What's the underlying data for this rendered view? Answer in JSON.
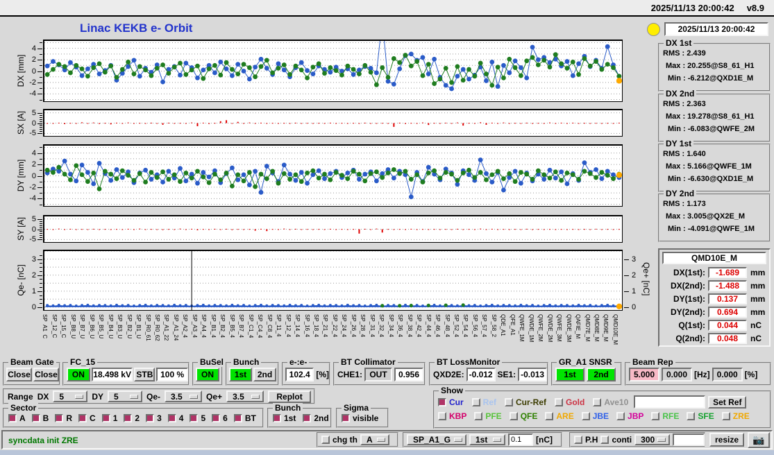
{
  "top_bar": {
    "datetime": "2025/11/13 20:00:42",
    "version": "v8.9"
  },
  "header": {
    "chart_title": "Linac KEKB e- Orbit",
    "timestamp": "2025/11/13 20:00:42",
    "indicator": "yellow-status-lamp"
  },
  "stats": {
    "dx1": {
      "title": "DX 1st",
      "rms": "RMS :  2.439",
      "max": "Max :  20.255@S8_61_H1",
      "min": "Min :  -6.212@QXD1E_M"
    },
    "dx2": {
      "title": "DX 2nd",
      "rms": "RMS :  2.363",
      "max": "Max :  19.278@S8_61_H1",
      "min": "Min :  -6.083@QWFE_2M"
    },
    "dy1": {
      "title": "DY 1st",
      "rms": "RMS :  1.640",
      "max": "Max :  5.166@QWFE_1M",
      "min": "Min :  -6.630@QXD1E_M"
    },
    "dy2": {
      "title": "DY 2nd",
      "rms": "RMS :  1.173",
      "max": "Max :  3.005@QX2E_M",
      "min": "Min :  -4.091@QWFE_1M"
    }
  },
  "selected_monitor": {
    "name": "QMD10E_M",
    "rows": [
      {
        "label": "DX(1st):",
        "value": "-1.689",
        "unit": "mm"
      },
      {
        "label": "DX(2nd):",
        "value": "-1.488",
        "unit": "mm"
      },
      {
        "label": "DY(1st):",
        "value": "0.137",
        "unit": "mm"
      },
      {
        "label": "DY(2nd):",
        "value": "0.694",
        "unit": "mm"
      },
      {
        "label": "Q(1st):",
        "value": "0.044",
        "unit": "nC"
      },
      {
        "label": "Q(2nd):",
        "value": "0.048",
        "unit": "nC"
      }
    ],
    "value_color": "#dd0000"
  },
  "controls_row1": {
    "beam_gate": {
      "title": "Beam Gate",
      "btn1": "Close",
      "btn2": "Close"
    },
    "fc_15": {
      "title": "FC_15",
      "on": "ON",
      "kv": "18.498 kV",
      "stb": "STB",
      "percent": "100 %"
    },
    "busel": {
      "title": "BuSel",
      "on": "ON"
    },
    "bunch": {
      "title": "Bunch",
      "first": "1st",
      "second": "2nd"
    },
    "ee": {
      "title": "e-:e-",
      "value": "102.4",
      "unit": "[%]"
    },
    "bt_collimator": {
      "title": "BT Collimator",
      "che1_label": "CHE1:",
      "che1_state": "OUT",
      "value": "0.956"
    },
    "bt_lossmonitor": {
      "title": "BT LossMonitor",
      "qxd2e_label": "QXD2E:",
      "qxd2e": "-0.012",
      "se1_label": "SE1:",
      "se1": "-0.013"
    },
    "gr_a1": {
      "title": "GR_A1 SNSR",
      "first": "1st",
      "second": "2nd"
    },
    "beam_rep": {
      "title": "Beam Rep",
      "v1": "5.000",
      "v2": "0.000",
      "hz": "[Hz]",
      "v3": "0.000",
      "pct": "[%]"
    }
  },
  "range_bar": {
    "label": "Range",
    "dx_label": "DX",
    "dx": "5",
    "dy_label": "DY",
    "dy": "5",
    "qem_label": "Qe-",
    "qem": "3.5",
    "qep_label": "Qe+",
    "qep": "3.5",
    "replot": "Replot"
  },
  "sector": {
    "title": "Sector",
    "items": [
      "A",
      "B",
      "R",
      "C",
      "1",
      "2",
      "3",
      "4",
      "5",
      "6",
      "BT"
    ],
    "checked": [
      true,
      true,
      true,
      true,
      true,
      true,
      true,
      true,
      true,
      true,
      true
    ]
  },
  "bunch2": {
    "title": "Bunch",
    "items": [
      "1st",
      "2nd"
    ],
    "checked": [
      true,
      true
    ]
  },
  "sigma": {
    "title": "Sigma",
    "item": "visible",
    "checked": true
  },
  "show": {
    "title": "Show",
    "row1": [
      {
        "label": "Cur",
        "color": "#2222cc",
        "checked": true
      },
      {
        "label": "Ref",
        "color": "#a9c4ef",
        "checked": false
      },
      {
        "label": "Cur-Ref",
        "color": "#3c3c00",
        "checked": false
      },
      {
        "label": "Gold",
        "color": "#cc3344",
        "checked": false
      },
      {
        "label": "Ave10",
        "color": "#909090",
        "checked": false
      }
    ],
    "ref_input_value": "",
    "set_ref": "Set Ref",
    "row2": [
      {
        "label": "KBP",
        "color": "#d4006a",
        "checked": false
      },
      {
        "label": "PFE",
        "color": "#58c33a",
        "checked": false
      },
      {
        "label": "QFE",
        "color": "#2e8000",
        "checked": false
      },
      {
        "label": "ARE",
        "color": "#f0a800",
        "checked": false
      },
      {
        "label": "JBE",
        "color": "#2f5fe8",
        "checked": false
      },
      {
        "label": "JBP",
        "color": "#d4009a",
        "checked": false
      },
      {
        "label": "RFE",
        "color": "#49c349",
        "checked": false
      },
      {
        "label": "SFE",
        "color": "#15a12f",
        "checked": false
      },
      {
        "label": "ZRE",
        "color": "#f0a800",
        "checked": false
      }
    ]
  },
  "status_bar": {
    "message": "syncdata init ZRE",
    "message_color": "#007700",
    "chg_th": "chg th",
    "chg_th_option": "A",
    "sp_option": "SP_A1_G",
    "bunch_option": "1st",
    "threshold": "0.1",
    "unit": "[nC]",
    "ph": "P.H",
    "conti": "conti",
    "points_option": "300",
    "extra_input_value": "",
    "resize": "resize",
    "camera_icon": "camera"
  },
  "colors": {
    "accent_blue": "#2a5bc8",
    "accent_green": "#1f7d1f",
    "bar_red": "#e00000",
    "highlight_orange": "#ffaa00",
    "title_blue": "#2233cc",
    "lamp_yellow": "#ffee00"
  },
  "x_labels": [
    "SP_A1_C",
    "SP_12_C",
    "SP_15_C",
    "SP_B8_U",
    "SP_B7_U",
    "SP_B6_U",
    "SP_B5_U",
    "SP_B4_U",
    "SP_B3_U",
    "SP_B2_U",
    "SP_B1_U",
    "SP_R0_61",
    "SP_R0_62",
    "SP_A1_22",
    "SP_A1_24",
    "SP_A2_4",
    "SP_A3_4",
    "SP_A4_4",
    "SP_B1_4",
    "SP_B2_4",
    "SP_B5_4",
    "SP_B7_4",
    "SP_C1_4",
    "SP_C4_4",
    "SP_C8_4",
    "SP_11_4",
    "SP_12_4",
    "SP_14_4",
    "SP_16_4",
    "SP_18_4",
    "SP_21_4",
    "SP_22_4",
    "SP_24_4",
    "SP_26_4",
    "SP_28_4",
    "SP_31_4",
    "SP_32_4",
    "SP_34_4",
    "SP_36_4",
    "SP_38_4",
    "SP_42_4",
    "SP_44_4",
    "SP_46_4",
    "SP_48_4",
    "SP_52_4",
    "SP_54_4",
    "SP_56_4",
    "SP_57_4",
    "SP_58_2",
    "QDE_A1",
    "QFE_A1",
    "QWFE_1M",
    "QWDE_1M",
    "QWFE_2M",
    "QWDE_2M",
    "QWFE_3M",
    "QWDE_3M",
    "QAFIE_M",
    "QMD7E_M",
    "QMD8E_M",
    "QMD9E_M",
    "QMD10E_M"
  ],
  "chart_data": [
    {
      "id": "dx",
      "type": "scatter",
      "ylabel": "DX [mm]",
      "ylim": [
        -5.3,
        5.3
      ],
      "yticks": [
        4,
        2,
        0,
        -2,
        -4
      ],
      "minor_step": 1,
      "minor_range": [
        -5,
        5
      ],
      "grid": 1,
      "series": [
        {
          "name": "1st",
          "color": "#2a5bc8",
          "values": [
            0.9,
            1.7,
            1.1,
            0.2,
            1.5,
            0.7,
            -0.8,
            0.4,
            1.2,
            -0.5,
            0.1,
            1.0,
            -1.6,
            -0.4,
            0.8,
            1.9,
            -0.9,
            0.5,
            -0.2,
            1.1,
            -1.9,
            0.3,
            0.8,
            -0.7,
            1.4,
            0.6,
            -1.2,
            0.2,
            1.0,
            -0.3,
            1.6,
            0.4,
            -0.8,
            1.2,
            0.0,
            -1.4,
            0.7,
            2.1,
            0.5,
            -0.6,
            1.3,
            0.2,
            -1.0,
            0.6,
            1.5,
            0.1,
            -0.5,
            0.9,
            0.3,
            -0.2,
            0.7,
            0.0,
            0.4,
            -0.6,
            0.2,
            0.8,
            0.5,
            -0.3,
            9.0,
            -1.8,
            -2.3,
            0.4,
            2.7,
            3.0,
            1.9,
            2.4,
            -0.5,
            2.1,
            -1.1,
            -2.5,
            -3.1,
            -0.9,
            0.3,
            -1.4,
            -0.7,
            0.7,
            -1.7,
            1.6,
            -2.7,
            1.0,
            -0.3,
            1.8,
            0.6,
            -1.2,
            4.2,
            2.0,
            2.4,
            1.5,
            2.1,
            0.9,
            1.7,
            -0.8,
            1.3,
            2.6,
            0.8,
            1.9,
            0.5,
            4.3,
            1.1,
            -0.9
          ]
        },
        {
          "name": "2nd",
          "color": "#1f7d1f",
          "values": [
            -0.6,
            0.3,
            1.2,
            0.8,
            -0.3,
            1.0,
            0.4,
            -0.9,
            0.6,
            1.3,
            -0.2,
            0.9,
            -1.1,
            0.3,
            1.6,
            -0.5,
            0.8,
            0.2,
            -0.8,
            0.5,
            1.1,
            -0.4,
            0.7,
            1.4,
            -0.6,
            0.2,
            0.9,
            -1.3,
            0.4,
            1.0,
            -0.7,
            1.5,
            0.3,
            -0.5,
            1.2,
            0.6,
            -1.0,
            0.8,
            1.9,
            -0.3,
            0.5,
            1.1,
            -0.6,
            0.9,
            0.2,
            -1.2,
            0.7,
            1.3,
            -0.4,
            0.6,
            0.1,
            -0.7,
            0.9,
            0.3,
            -0.5,
            1.0,
            -0.2,
            -2.4,
            0.6,
            -1.1,
            2.2,
            1.5,
            2.8,
            0.9,
            1.7,
            -0.8,
            1.2,
            -2.2,
            -1.4,
            0.5,
            -2.0,
            0.8,
            -1.6,
            0.3,
            -0.9,
            1.4,
            -0.5,
            -2.5,
            0.7,
            -1.2,
            2.1,
            0.6,
            -0.8,
            1.8,
            2.4,
            1.1,
            1.9,
            0.7,
            2.9,
            1.3,
            0.5,
            1.6,
            -0.6,
            2.2,
            0.9,
            1.7,
            0.3,
            1.2,
            0.6,
            -0.9
          ]
        }
      ],
      "last": {
        "value": -1.689,
        "color": "#ffaa00"
      }
    },
    {
      "id": "sx",
      "type": "bars",
      "ylabel": "SX [A]",
      "ylim": [
        -6.2,
        6.2
      ],
      "yticks": [
        5,
        0,
        -5
      ],
      "minor_step": 1,
      "minor_range": [
        -5,
        5
      ],
      "grid": 5,
      "color": "#e00000",
      "values": [
        -0.1,
        -0.3,
        0.2,
        -0.5,
        0.1,
        -0.2,
        0.4,
        -0.1,
        0.3,
        -0.4,
        0.1,
        -0.6,
        0.2,
        -0.1,
        0.3,
        -0.2,
        0.1,
        -0.3,
        0.2,
        -0.1,
        -0.8,
        0.2,
        -0.3,
        0.1,
        -0.2,
        0.3,
        -1.5,
        0.2,
        -0.4,
        0.1,
        0.9,
        1.4,
        -0.3,
        0.6,
        -0.2,
        0.3,
        -0.1,
        0.2,
        -0.3,
        0.1,
        -0.2,
        0.1,
        -0.1,
        0.2,
        -0.1,
        0.1,
        -0.2,
        0.1,
        -0.1,
        0.2,
        -0.1,
        0.1,
        -0.2,
        0.1,
        -0.1,
        0.2,
        -0.1,
        -0.3,
        0.1,
        -0.2,
        -1.8,
        0.2,
        -0.4,
        0.1,
        -0.2,
        0.3,
        -0.9,
        0.1,
        -0.3,
        0.2,
        -0.1,
        0.3,
        -1.2,
        0.1,
        -0.2,
        0.4,
        -0.8,
        0.2,
        -0.1,
        0.3,
        -0.2,
        0.1,
        -0.3,
        0.2,
        -0.1,
        0.1,
        -0.2,
        0.3,
        -0.1,
        0.2,
        -0.1,
        0.2,
        -0.1,
        0.1,
        -0.3,
        0.1,
        -0.2,
        0.1,
        -0.1,
        0.2
      ]
    },
    {
      "id": "dy",
      "type": "scatter",
      "ylabel": "DY [mm]",
      "ylim": [
        -5.3,
        5.3
      ],
      "yticks": [
        4,
        2,
        0,
        -2,
        -4
      ],
      "minor_step": 1,
      "minor_range": [
        -5,
        5
      ],
      "grid": 1,
      "series": [
        {
          "name": "1st",
          "color": "#2a5bc8",
          "values": [
            0.5,
            1.2,
            0.8,
            2.6,
            0.3,
            -0.9,
            1.9,
            0.6,
            -1.4,
            2.2,
            0.4,
            -0.8,
            1.1,
            -0.3,
            0.7,
            -1.2,
            0.5,
            1.0,
            -0.6,
            0.2,
            -1.1,
            0.8,
            -0.4,
            1.3,
            -0.9,
            0.3,
            -1.3,
            0.6,
            -0.2,
            0.9,
            -1.2,
            0.4,
            1.4,
            -0.7,
            0.2,
            -1.6,
            0.8,
            -2.9,
            1.7,
            0.5,
            -1.0,
            1.9,
            0.3,
            -0.8,
            0.6,
            -1.3,
            0.2,
            0.9,
            -0.5,
            0.4,
            0.8,
            -0.3,
            0.5,
            1.0,
            -0.6,
            0.3,
            0.7,
            -0.9,
            0.4,
            1.1,
            -0.4,
            0.8,
            0.2,
            -3.7,
            0.6,
            -1.0,
            1.5,
            0.3,
            -0.7,
            1.2,
            0.5,
            -1.5,
            0.9,
            0.2,
            -0.8,
            2.8,
            0.4,
            -1.1,
            0.6,
            -2.5,
            -0.3,
            0.8,
            -1.3,
            0.5,
            -0.9,
            0.3,
            -0.6,
            1.0,
            -0.4,
            0.7,
            -1.4,
            0.4,
            -0.8,
            2.3,
            0.6,
            1.1,
            -0.5,
            0.8,
            0.2,
            -0.3
          ]
        },
        {
          "name": "2nd",
          "color": "#1f7d1f",
          "values": [
            1.0,
            0.6,
            1.5,
            0.3,
            -0.7,
            1.8,
            0.2,
            -1.0,
            0.5,
            -2.3,
            0.8,
            0.3,
            -0.5,
            0.9,
            0.1,
            -0.8,
            0.4,
            -1.1,
            0.6,
            -0.3,
            0.7,
            -0.6,
            0.2,
            -1.0,
            0.5,
            -0.4,
            0.8,
            -0.2,
            -1.2,
            0.3,
            -0.7,
            0.5,
            -1.8,
            0.2,
            -0.9,
            0.6,
            -1.9,
            0.3,
            -0.5,
            0.8,
            -1.3,
            0.4,
            -0.6,
            0.2,
            -1.0,
            0.5,
            0.9,
            -0.4,
            0.3,
            -0.7,
            0.6,
            0.1,
            -0.5,
            0.8,
            0.3,
            -0.9,
            0.4,
            0.7,
            -0.3,
            0.5,
            1.1,
            0.4,
            0.8,
            -0.6,
            0.2,
            -1.1,
            0.5,
            0.9,
            -0.4,
            0.6,
            0.3,
            -0.8,
            0.5,
            1.0,
            -0.3,
            0.6,
            -0.7,
            0.2,
            0.8,
            -0.5,
            0.4,
            -1.0,
            0.6,
            0.3,
            -0.6,
            0.9,
            0.2,
            -0.4,
            0.7,
            -0.8,
            0.5,
            0.2,
            -0.6,
            0.8,
            0.4,
            -0.3,
            0.6,
            0.1,
            -0.5,
            0.3
          ]
        }
      ],
      "last": {
        "value": 0.137,
        "color": "#ffaa00"
      }
    },
    {
      "id": "sy",
      "type": "bars",
      "ylabel": "SY [A]",
      "ylim": [
        -6.2,
        6.2
      ],
      "yticks": [
        5,
        0,
        -5
      ],
      "minor_step": 1,
      "minor_range": [
        -5,
        5
      ],
      "grid": 5,
      "color": "#e00000",
      "values": [
        0.1,
        -0.2,
        0.3,
        -0.1,
        0.2,
        -0.3,
        0.1,
        -0.1,
        0.2,
        -0.2,
        0.1,
        -0.3,
        0.1,
        -0.2,
        0.2,
        -0.1,
        0.3,
        -0.2,
        0.1,
        -0.1,
        -0.4,
        0.1,
        -0.2,
        0.3,
        -0.1,
        0.2,
        -0.5,
        0.1,
        -0.3,
        0.2,
        -0.1,
        0.2,
        -0.4,
        0.1,
        -0.2,
        0.1,
        -0.7,
        0.2,
        -0.9,
        0.1,
        -0.2,
        0.3,
        -0.1,
        0.2,
        -0.3,
        0.1,
        -0.2,
        0.1,
        -0.1,
        0.2,
        -0.1,
        0.1,
        -0.2,
        0.1,
        -2.1,
        0.2,
        -0.1,
        0.3,
        -1.6,
        0.1,
        -0.2,
        0.1,
        -0.3,
        0.2,
        -0.1,
        0.1,
        -0.2,
        0.1,
        -0.3,
        0.1,
        -0.1,
        0.2,
        -0.2,
        0.1,
        -0.1,
        0.3,
        -0.1,
        0.2,
        -0.1,
        0.1,
        -0.2,
        0.1,
        -0.1,
        0.2,
        -0.1,
        0.1,
        -0.3,
        0.1,
        -0.2,
        0.1,
        -0.1,
        0.1,
        -0.2,
        0.1,
        -0.1,
        0.2,
        -0.1,
        0.1,
        -0.2,
        0.1
      ]
    },
    {
      "id": "qe",
      "type": "area",
      "ylabel": "Qe- [nC]",
      "ylabel_right": "Qe+ [nC]",
      "ylim": [
        -0.18,
        3.5
      ],
      "yticks": [
        0,
        1,
        2,
        3
      ],
      "yticks_right": [
        0,
        1,
        2,
        3
      ],
      "minor_step": 0.25,
      "minor_range": [
        0,
        3.25
      ],
      "grid": 0.5,
      "color": "#2a5bc8",
      "values": [
        0.11,
        0.09,
        0.13,
        0.1,
        0.12,
        0.08,
        0.11,
        0.13,
        0.09,
        0.12,
        0.11,
        0.09,
        0.13,
        0.1,
        0.12,
        0.08,
        0.11,
        0.13,
        0.09,
        0.12,
        0.11,
        0.09,
        0.13,
        0.1,
        0.12,
        0.08,
        0.11,
        0.13,
        0.09,
        0.12,
        0.11,
        0.09,
        0.13,
        0.1,
        0.12,
        0.08,
        0.11,
        0.13,
        0.09,
        0.12,
        0.11,
        0.09,
        0.13,
        0.1,
        0.12,
        0.08,
        0.11,
        0.13,
        0.09,
        0.12,
        0.11,
        0.09,
        0.13,
        0.1,
        0.12,
        0.08,
        0.11,
        0.13,
        0.09,
        0.12,
        0.11,
        0.09,
        0.13,
        0.1,
        0.12,
        0.08,
        0.11,
        0.13,
        0.09,
        0.12,
        0.11,
        0.09,
        0.13,
        0.1,
        0.12,
        0.08,
        0.11,
        0.13,
        0.09,
        0.12,
        0.11,
        0.09,
        0.13,
        0.1,
        0.12,
        0.08,
        0.11,
        0.13,
        0.09,
        0.12,
        0.11,
        0.09,
        0.13,
        0.1,
        0.12,
        0.08,
        0.11,
        0.13,
        0.09,
        0.12
      ],
      "green_indices": [
        58,
        61,
        63,
        66,
        69,
        72
      ],
      "event_line_index": 25,
      "last": {
        "value": 0.044,
        "color": "#ffaa00"
      }
    }
  ]
}
